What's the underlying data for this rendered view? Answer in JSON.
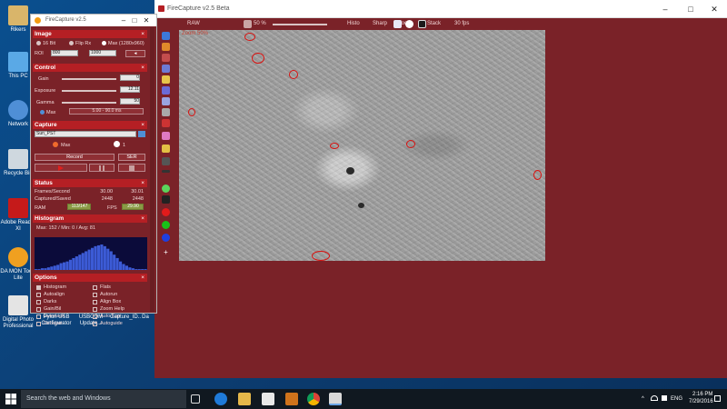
{
  "desktop": {
    "icons": [
      {
        "label": "Rikers",
        "color": "#d9b56a"
      },
      {
        "label": "This PC",
        "color": "#5aa9e6"
      },
      {
        "label": "Network",
        "color": "#4f8fd6"
      },
      {
        "label": "Recycle Bin",
        "color": "#cfd8df"
      },
      {
        "label": "Adobe Reader XI",
        "color": "#c51a1a"
      },
      {
        "label": "DA MON Tools Lite",
        "color": "#f0a020"
      },
      {
        "label": "Digital Photo Professional",
        "color": "#e4e4e4"
      }
    ],
    "bottom_icons": [
      "Pylon USB Configurator",
      "USBCOM Update...",
      "Capture_ID..",
      "Da"
    ]
  },
  "fc_window": {
    "title": "FireCapture v2.5 Beta",
    "toolbar": {
      "fps": "30 fps",
      "zoom_label": "50 %",
      "items": [
        "RAW",
        "Histo",
        "Sharp",
        "Focus",
        "Stack"
      ]
    },
    "image_zoom": "Zoom 50%",
    "colors": {
      "window_bg": "#7a2228",
      "accent": "#b51f24",
      "marker": "#d9110f"
    }
  },
  "panel": {
    "title": "FireCapture v2.5",
    "image": {
      "heading": "Image",
      "options": [
        "16 Bit",
        "Flip Rx",
        "Max (1280x960)"
      ],
      "roi_w": "800",
      "roi_h": "1000",
      "roi_label": "ROI"
    },
    "control": {
      "heading": "Control",
      "rows": [
        {
          "label": "Gain",
          "value": "0"
        },
        {
          "label": "Exposure",
          "value": "12.11"
        },
        {
          "label": "Gamma",
          "value": "50"
        }
      ],
      "auto_label": "Max",
      "range": "5.00 - 90.0 ms"
    },
    "capture": {
      "heading": "Capture",
      "profile": "Sun_PST",
      "mode_label": "Max",
      "count": "1",
      "buttons": [
        "Capture",
        "Stop",
        "Pause"
      ],
      "small": "SER",
      "main_btn": "Record"
    },
    "status": {
      "heading": "Status",
      "rows": [
        {
          "label": "Frames/Second",
          "a": "30.00",
          "b": "30.01"
        },
        {
          "label": "Captured/Saved",
          "a": "2448",
          "b": "2448"
        }
      ],
      "ram_label": "RAM",
      "ram_value": "113/147",
      "fps_label": "FPS",
      "fps_value": "29.90"
    },
    "histogram": {
      "heading": "Histogram",
      "info": "Max: 152 / Min: 0 / Avg: 81",
      "bins": [
        1,
        1,
        2,
        2,
        3,
        4,
        5,
        6,
        8,
        9,
        10,
        12,
        14,
        16,
        18,
        20,
        22,
        24,
        26,
        28,
        29,
        30,
        28,
        25,
        22,
        18,
        14,
        10,
        7,
        5,
        3,
        2,
        1,
        1,
        1,
        1
      ]
    },
    "options": {
      "heading": "Options",
      "items": [
        "Histogram",
        "Autoalign",
        "Darks",
        "Gain/Bil",
        "Livestack",
        "Debayer",
        "Flats",
        "Autorun",
        "Align Box",
        "Zoom Help",
        "Auto Exp",
        "Autoguide"
      ]
    }
  },
  "taskbar": {
    "search_placeholder": "Search the web and Windows",
    "time": "2:16 PM",
    "date": "7/29/2016",
    "lang": "ENG"
  }
}
